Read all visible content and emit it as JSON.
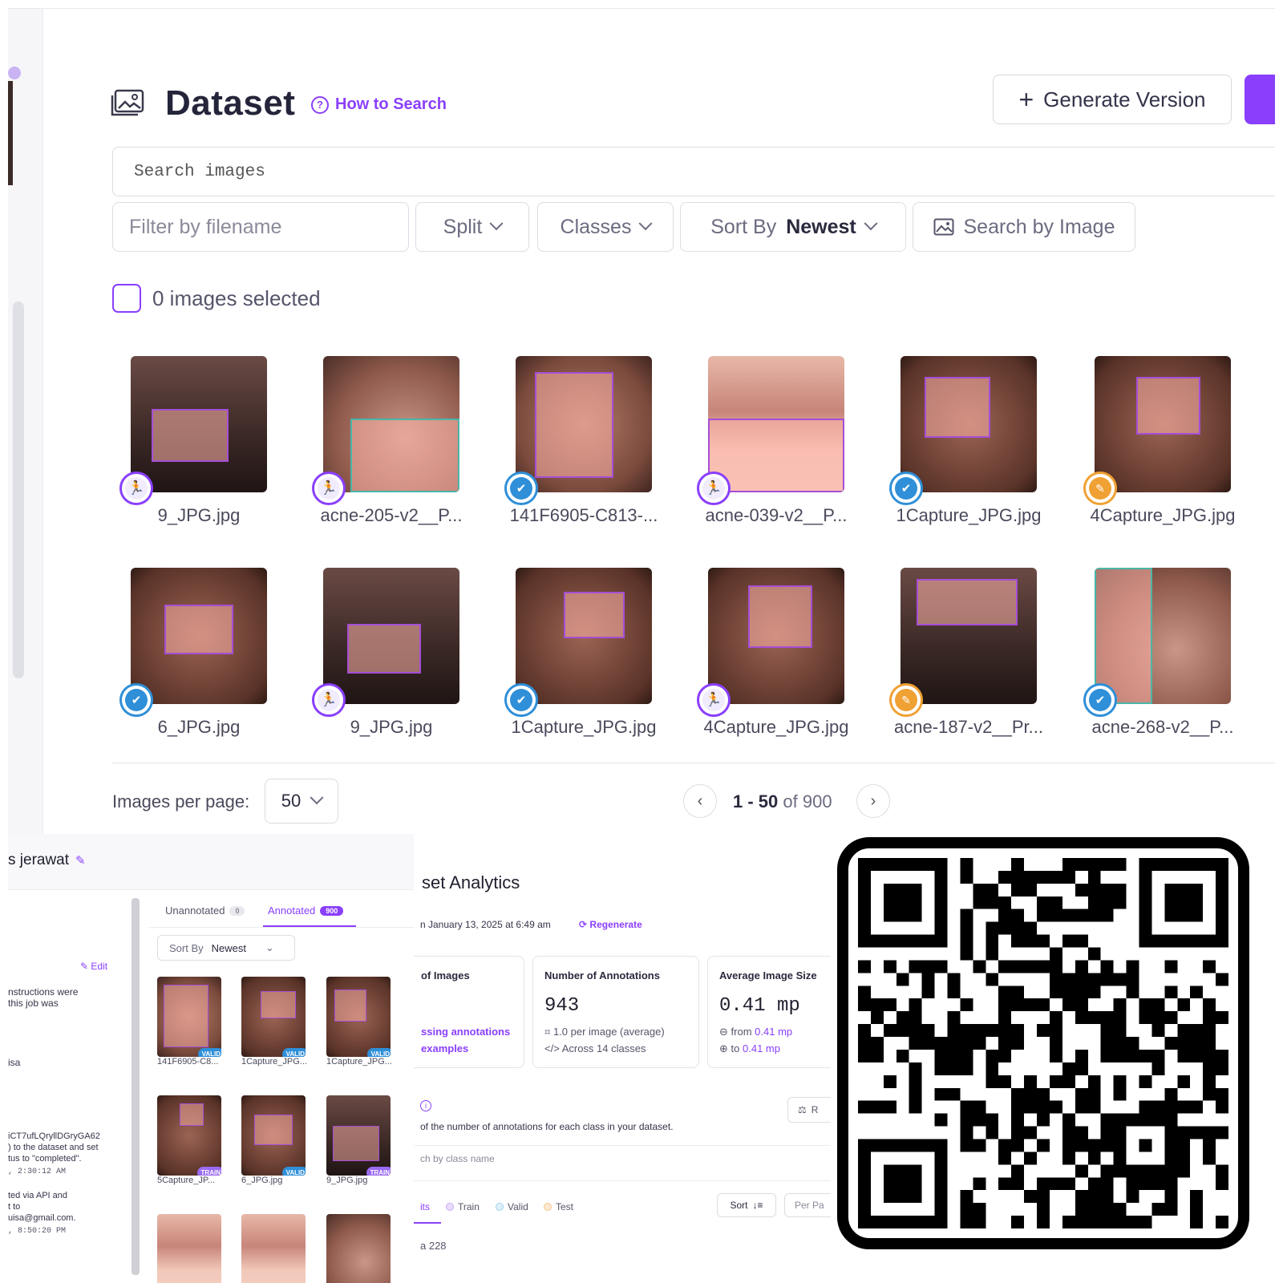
{
  "header": {
    "title": "Dataset",
    "how_to_search": "How to Search",
    "generate_version": "Generate Version"
  },
  "search": {
    "placeholder": "Search images"
  },
  "filters": {
    "filename_placeholder": "Filter by filename",
    "split": "Split",
    "classes": "Classes",
    "sort_label": "Sort By",
    "sort_value": "Newest",
    "search_by_image": "Search by Image"
  },
  "selection": {
    "text": "0 images selected"
  },
  "images": [
    {
      "name": "9_JPG.jpg",
      "status": "train"
    },
    {
      "name": "acne-205-v2__P...",
      "status": "train"
    },
    {
      "name": "141F6905-C813-...",
      "status": "valid"
    },
    {
      "name": "acne-039-v2__P...",
      "status": "train"
    },
    {
      "name": "1Capture_JPG.jpg",
      "status": "valid"
    },
    {
      "name": "4Capture_JPG.jpg",
      "status": "test"
    },
    {
      "name": "6_JPG.jpg",
      "status": "valid"
    },
    {
      "name": "9_JPG.jpg",
      "status": "train"
    },
    {
      "name": "1Capture_JPG.jpg",
      "status": "valid"
    },
    {
      "name": "4Capture_JPG.jpg",
      "status": "train"
    },
    {
      "name": "acne-187-v2__Pr...",
      "status": "test"
    },
    {
      "name": "acne-268-v2__P...",
      "status": "valid"
    }
  ],
  "pagination": {
    "per_page_label": "Images per page:",
    "per_page_value": "50",
    "range": "1 - 50",
    "of_total": "of 900"
  },
  "annotate_panel": {
    "title": "s jerawat",
    "tab_unannotated": "Unannotated",
    "tab_unannotated_count": "0",
    "tab_annotated": "Annotated",
    "tab_annotated_count": "900",
    "sort_label": "Sort By",
    "sort_value": "Newest",
    "edit": "Edit",
    "text1": "nstructions were",
    "text2": "this job was",
    "text3": "isa",
    "text4": "iCT7ufLQryllDGryGA62",
    "text5": ") to the dataset and set",
    "text6": "tus to \"completed\".",
    "time1": ", 2:30:12 AM",
    "text7": "ted via API and",
    "text8": "t to",
    "text9": "uisa@gmail.com.",
    "time2": ", 8:50:20 PM",
    "thumbs": [
      {
        "name": "141F6905-C8...",
        "tag": "VALID"
      },
      {
        "name": "1Capture_JPG...",
        "tag": "VALID"
      },
      {
        "name": "1Capture_JPG...",
        "tag": "VALID"
      },
      {
        "name": "5Capture_JP...",
        "tag": "TRAIN"
      },
      {
        "name": "6_JPG.jpg",
        "tag": "VALID"
      },
      {
        "name": "9_JPG.jpg",
        "tag": "TRAIN"
      }
    ]
  },
  "analytics": {
    "title": "set Analytics",
    "date": "n January 13, 2025 at 6:49 am",
    "regenerate": "Regenerate",
    "stat_images_label": "of Images",
    "stat_images_link1": "ssing annotations",
    "stat_images_link2": "examples",
    "stat_ann_label": "Number of Annotations",
    "stat_ann_value": "943",
    "stat_ann_sub1": "1.0 per image (average)",
    "stat_ann_sub2": "Across 14 classes",
    "stat_size_label": "Average Image Size",
    "stat_size_value": "0.41 mp",
    "stat_size_from": "from",
    "stat_size_from_val": "0.41 mp",
    "stat_size_to": "to",
    "stat_size_to_val": "0.41 mp",
    "rebalance": "R",
    "description": "of the number of annotations for each class in your dataset.",
    "search_placeholder": "ch by class name",
    "splits_tab": "its",
    "legend_train": "Train",
    "legend_valid": "Valid",
    "legend_test": "Test",
    "sort": "Sort",
    "per_page": "Per Pa",
    "first_row": "a  228"
  },
  "colors": {
    "accent": "#8a3ffc",
    "valid": "#2f8fd8",
    "test": "#f0a133",
    "train_legend": "#c9a8f7",
    "valid_legend": "#9fd4f0",
    "test_legend": "#f6c48a"
  }
}
